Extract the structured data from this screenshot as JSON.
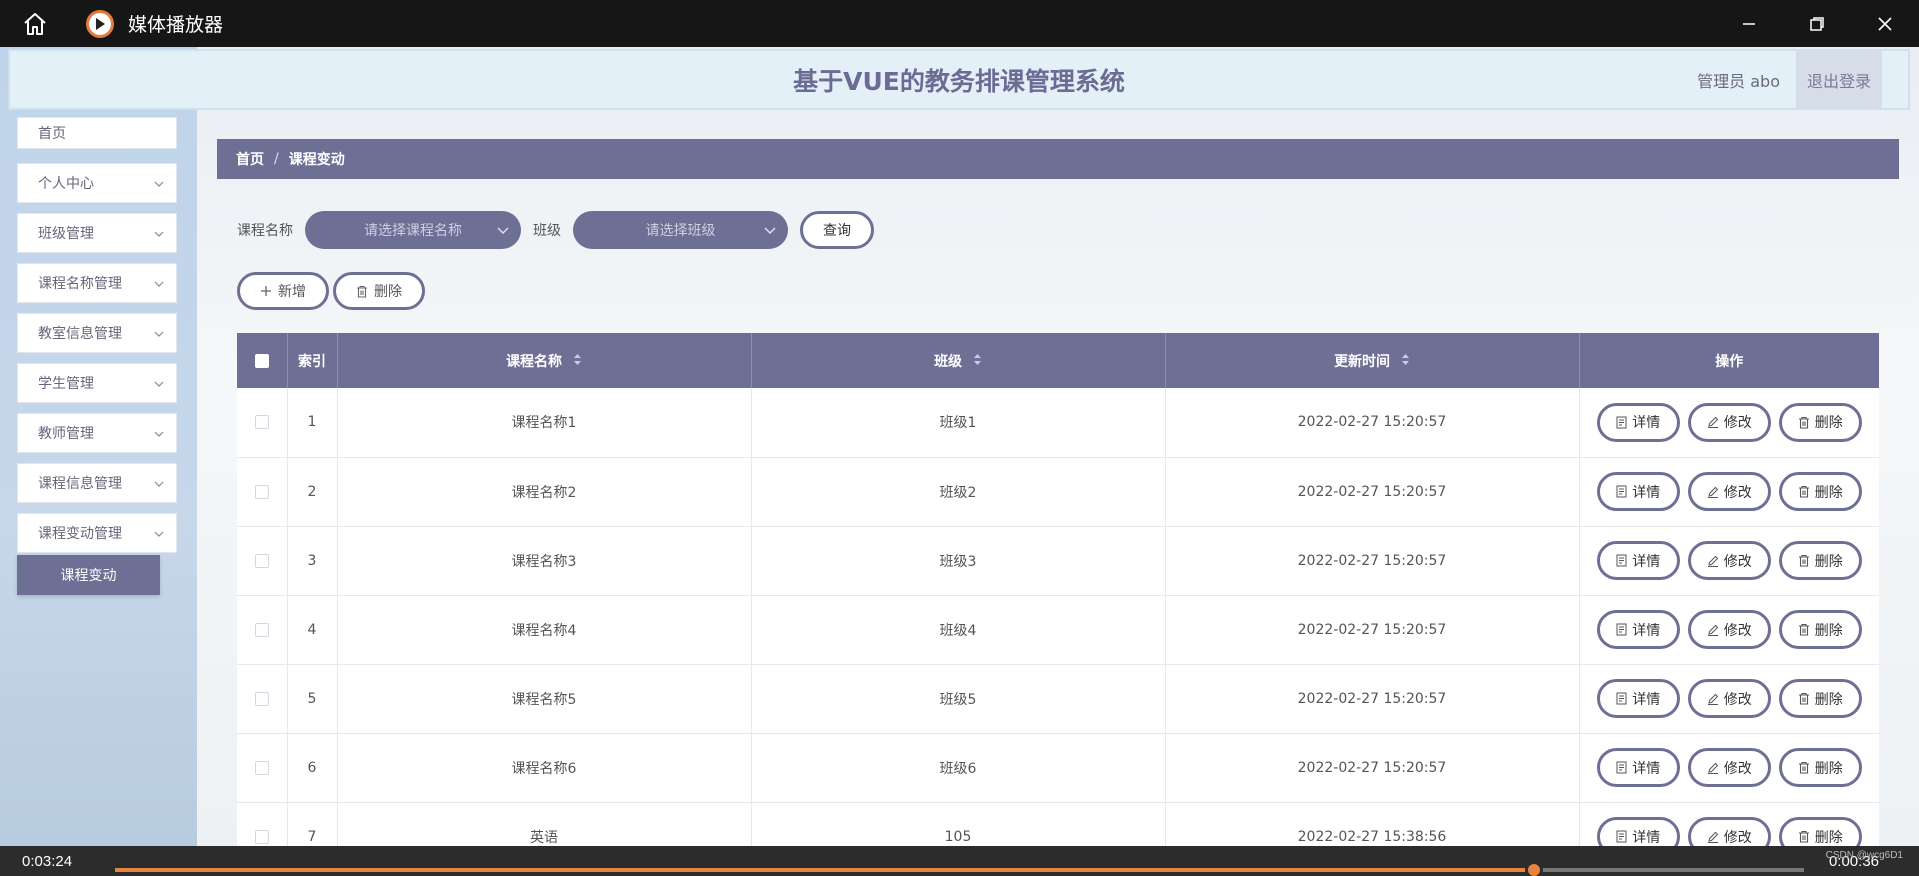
{
  "player": {
    "title": "媒体播放器",
    "current_time": "0:03:24",
    "total_time": "0:00:36",
    "progress": 0.84,
    "watermark": "CSDN @wcg6D1",
    "accent": "#e8843d"
  },
  "header": {
    "site_title": "基于VUE的教务排课管理系统",
    "admin_label": "管理员 abo",
    "logout_label": "退出登录"
  },
  "sidebar": {
    "items": [
      {
        "label": "首页"
      },
      {
        "label": "个人中心"
      },
      {
        "label": "班级管理"
      },
      {
        "label": "课程名称管理"
      },
      {
        "label": "教室信息管理"
      },
      {
        "label": "学生管理"
      },
      {
        "label": "教师管理"
      },
      {
        "label": "课程信息管理"
      },
      {
        "label": "课程变动管理"
      }
    ],
    "active_sub": "课程变动"
  },
  "breadcrumb": {
    "home": "首页",
    "separator": "/",
    "current": "课程变动"
  },
  "search": {
    "course_label": "课程名称",
    "course_placeholder": "请选择课程名称",
    "class_label": "班级",
    "class_placeholder": "请选择班级",
    "query_button": "查询"
  },
  "actions": {
    "add_label": "新增",
    "delete_label": "删除"
  },
  "table": {
    "columns": {
      "index": "索引",
      "course": "课程名称",
      "class": "班级",
      "updated": "更新时间",
      "ops": "操作"
    },
    "row_buttons": {
      "detail": "详情",
      "edit": "修改",
      "delete": "删除"
    },
    "rows": [
      {
        "index": "1",
        "course": "课程名称1",
        "class": "班级1",
        "updated": "2022-02-27 15:20:57"
      },
      {
        "index": "2",
        "course": "课程名称2",
        "class": "班级2",
        "updated": "2022-02-27 15:20:57"
      },
      {
        "index": "3",
        "course": "课程名称3",
        "class": "班级3",
        "updated": "2022-02-27 15:20:57"
      },
      {
        "index": "4",
        "course": "课程名称4",
        "class": "班级4",
        "updated": "2022-02-27 15:20:57"
      },
      {
        "index": "5",
        "course": "课程名称5",
        "class": "班级5",
        "updated": "2022-02-27 15:20:57"
      },
      {
        "index": "6",
        "course": "课程名称6",
        "class": "班级6",
        "updated": "2022-02-27 15:20:57"
      },
      {
        "index": "7",
        "course": "英语",
        "class": "105",
        "updated": "2022-02-27 15:38:56"
      }
    ]
  },
  "colors": {
    "primary": "#6d6f95",
    "header_bg": "#e3f0f8",
    "title_text": "#6b6b93"
  }
}
